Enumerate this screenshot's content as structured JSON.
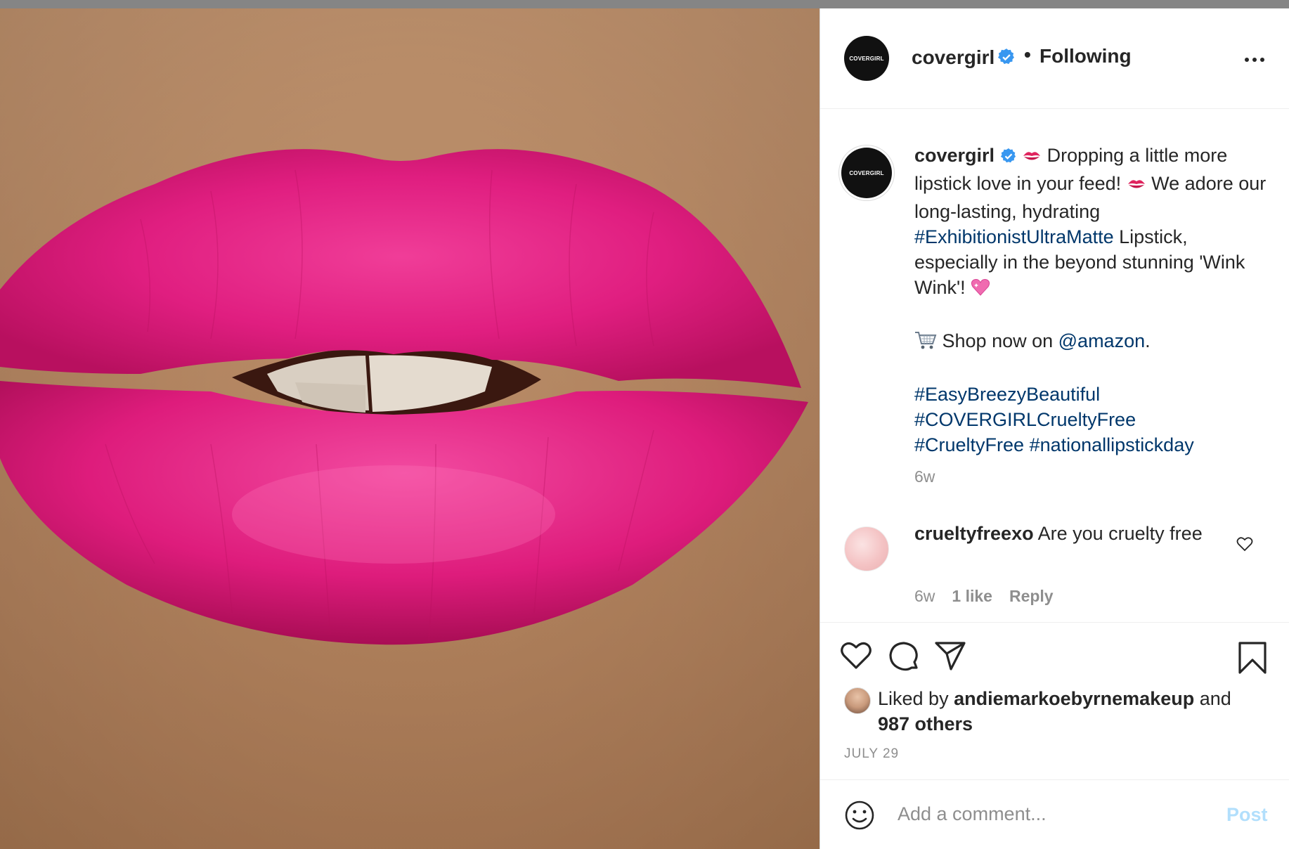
{
  "post": {
    "username": "covergirl",
    "avatar_text": "COVERGIRL",
    "follow_status": "Following",
    "separator": "•"
  },
  "caption": {
    "username": "covergirl",
    "part1": " Dropping a little more lipstick love in your feed! ",
    "part2": "  We adore our long-lasting, hydrating ",
    "hashtag_main": "#ExhibitionistUltraMatte",
    "part3": " Lipstick, especially in the beyond stunning 'Wink Wink'! ",
    "shop_text": " Shop now on ",
    "mention": "@amazon",
    "mention_suffix": ".",
    "hashtags": [
      "#EasyBreezyBeautiful",
      "#COVERGIRLCrueltyFree",
      "#CrueltyFree",
      "#nationallipstickday"
    ],
    "time": "6w"
  },
  "comment": {
    "username": "crueltyfreexo",
    "text": " Are you cruelty free",
    "time": "6w",
    "likes": "1 like",
    "reply": "Reply"
  },
  "likes": {
    "prefix": "Liked by ",
    "user": "andiemarkoebyrnemakeup",
    "connector": " and",
    "others": "987 others"
  },
  "date": "JULY 29",
  "add_comment": {
    "placeholder": "Add a comment...",
    "post_label": "Post"
  },
  "icons": {
    "verified": "verified-badge-icon",
    "kiss": "kiss-mark-icon",
    "heart_emoji": "sparkling-heart-icon",
    "cart": "shopping-cart-icon"
  },
  "colors": {
    "verified_blue": "#3897f0",
    "link_blue": "#00376b",
    "post_disabled": "#b2dffc",
    "lipstick": "#e0197a"
  }
}
